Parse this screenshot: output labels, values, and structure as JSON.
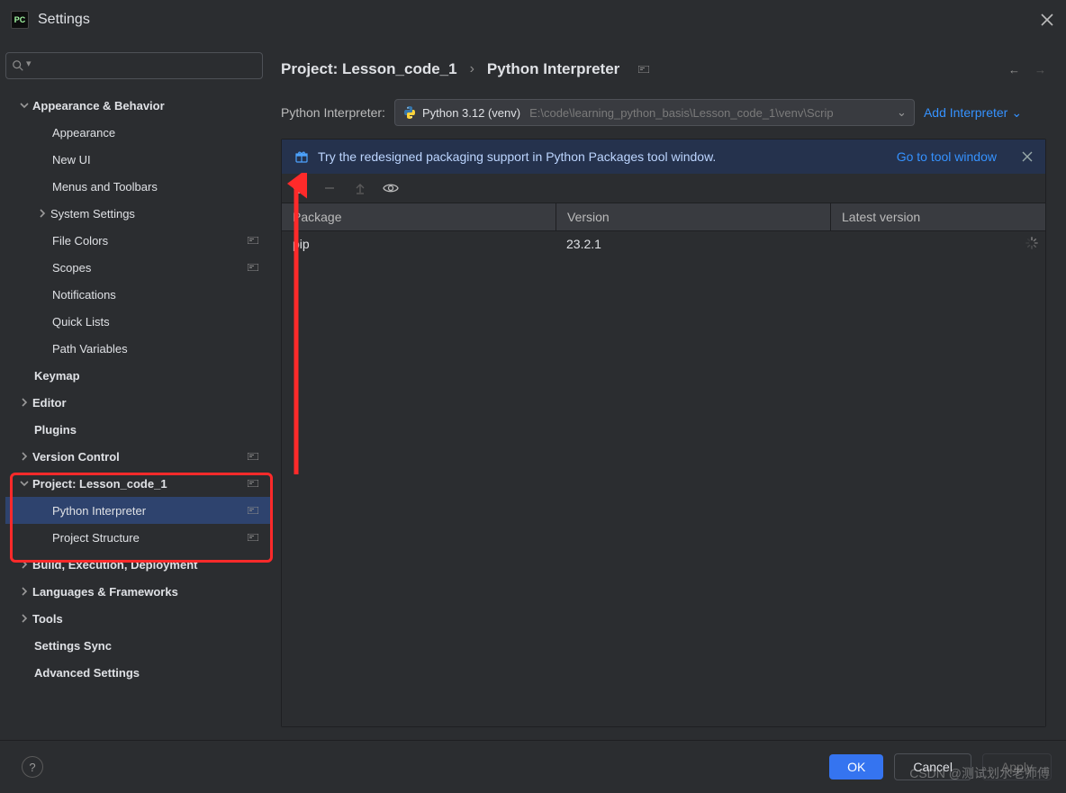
{
  "window": {
    "title": "Settings"
  },
  "search": {
    "placeholder": ""
  },
  "sidebar": [
    {
      "label": "Appearance & Behavior",
      "bold": true,
      "chev": "down",
      "indent": 0,
      "marker": false
    },
    {
      "label": "Appearance",
      "indent": 2
    },
    {
      "label": "New UI",
      "indent": 2
    },
    {
      "label": "Menus and Toolbars",
      "indent": 2
    },
    {
      "label": "System Settings",
      "indent": 1,
      "chev": "right"
    },
    {
      "label": "File Colors",
      "indent": 2,
      "marker": true
    },
    {
      "label": "Scopes",
      "indent": 2,
      "marker": true
    },
    {
      "label": "Notifications",
      "indent": 2
    },
    {
      "label": "Quick Lists",
      "indent": 2
    },
    {
      "label": "Path Variables",
      "indent": 2
    },
    {
      "label": "Keymap",
      "bold": true,
      "indent": 0,
      "plain": true
    },
    {
      "label": "Editor",
      "bold": true,
      "chev": "right",
      "indent": 0
    },
    {
      "label": "Plugins",
      "bold": true,
      "indent": 0,
      "plain": true
    },
    {
      "label": "Version Control",
      "bold": true,
      "chev": "right",
      "indent": 0,
      "marker": true
    },
    {
      "label": "Project: Lesson_code_1",
      "bold": true,
      "chev": "down",
      "indent": 0,
      "marker": true
    },
    {
      "label": "Python Interpreter",
      "indent": 2,
      "marker": true,
      "selected": true
    },
    {
      "label": "Project Structure",
      "indent": 2,
      "marker": true
    },
    {
      "label": "Build, Execution, Deployment",
      "bold": true,
      "chev": "right",
      "indent": 0
    },
    {
      "label": "Languages & Frameworks",
      "bold": true,
      "chev": "right",
      "indent": 0
    },
    {
      "label": "Tools",
      "bold": true,
      "chev": "right",
      "indent": 0
    },
    {
      "label": "Settings Sync",
      "bold": true,
      "indent": 0,
      "plain": true
    },
    {
      "label": "Advanced Settings",
      "bold": true,
      "indent": 0,
      "plain": true
    }
  ],
  "breadcrumb": {
    "a": "Project: Lesson_code_1",
    "sep": "›",
    "b": "Python Interpreter"
  },
  "interpreter": {
    "label": "Python Interpreter:",
    "name": "Python 3.12 (venv)",
    "path": "E:\\code\\learning_python_basis\\Lesson_code_1\\venv\\Scrip",
    "add": "Add Interpreter"
  },
  "banner": {
    "text": "Try the redesigned packaging support in Python Packages tool window.",
    "link": "Go to tool window"
  },
  "table": {
    "columns": {
      "pkg": "Package",
      "ver": "Version",
      "lat": "Latest version"
    },
    "rows": [
      {
        "pkg": "pip",
        "ver": "23.2.1",
        "lat": ""
      }
    ]
  },
  "footer": {
    "ok": "OK",
    "cancel": "Cancel",
    "apply": "Apply"
  },
  "watermark": "CSDN @测试划水老师傅"
}
